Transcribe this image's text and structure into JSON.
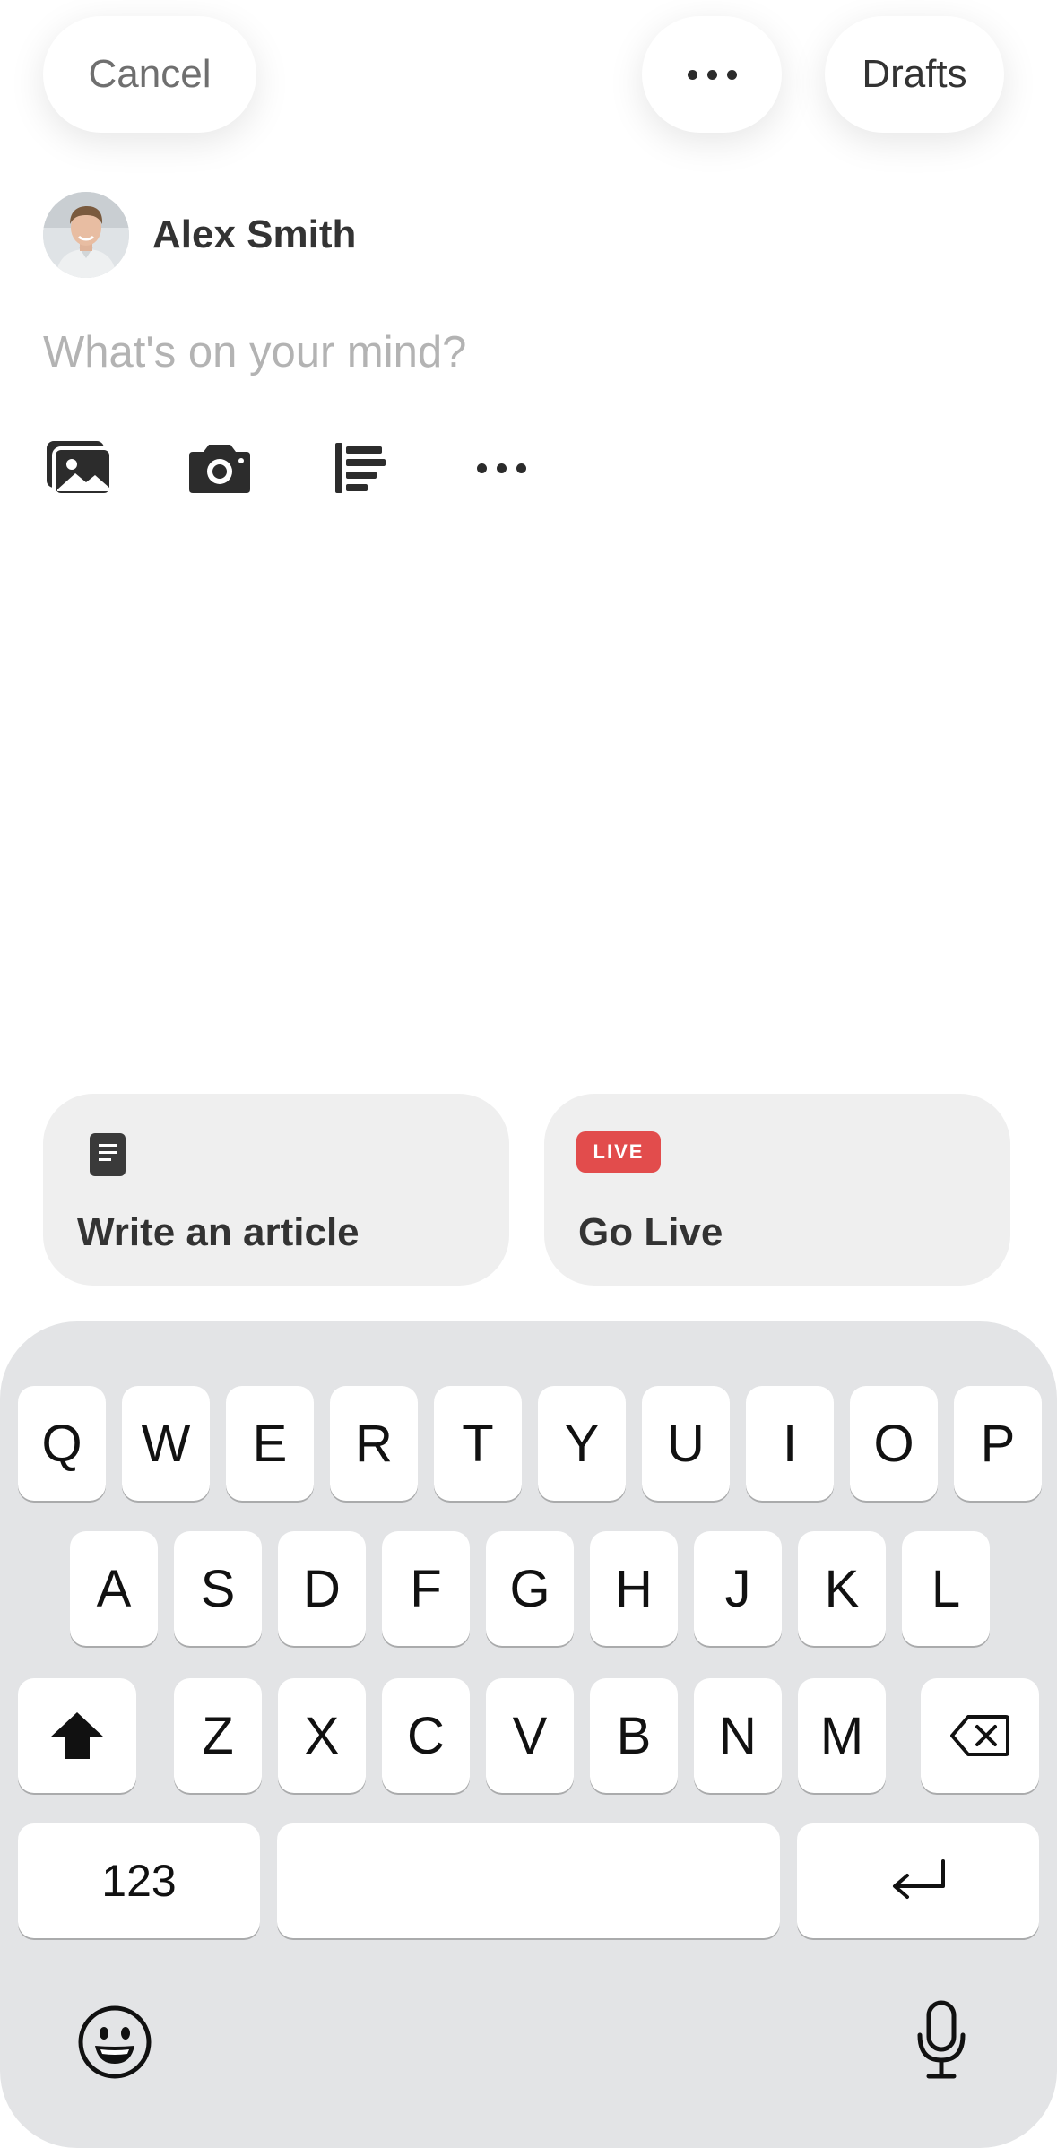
{
  "top_bar": {
    "cancel_label": "Cancel",
    "drafts_label": "Drafts",
    "more_icon": "more-horizontal-icon"
  },
  "author": {
    "name": "Alex Smith"
  },
  "composer": {
    "placeholder": "What's on your mind?",
    "value": ""
  },
  "toolbar": {
    "icons": [
      "photo-gallery-icon",
      "camera-icon",
      "poll-icon",
      "more-horizontal-icon"
    ]
  },
  "cards": {
    "article_label": "Write an article",
    "live_label": "Go Live",
    "live_badge": "LIVE",
    "live_badge_color": "#e24c4c"
  },
  "keyboard": {
    "row1": [
      "Q",
      "W",
      "E",
      "R",
      "T",
      "Y",
      "U",
      "I",
      "O",
      "P"
    ],
    "row2": [
      "A",
      "S",
      "D",
      "F",
      "G",
      "H",
      "J",
      "K",
      "L"
    ],
    "row3": [
      "Z",
      "X",
      "C",
      "V",
      "B",
      "N",
      "M"
    ],
    "numbers_label": "123",
    "icons": [
      "shift-icon",
      "backspace-icon",
      "return-icon",
      "emoji-icon",
      "microphone-icon"
    ]
  }
}
